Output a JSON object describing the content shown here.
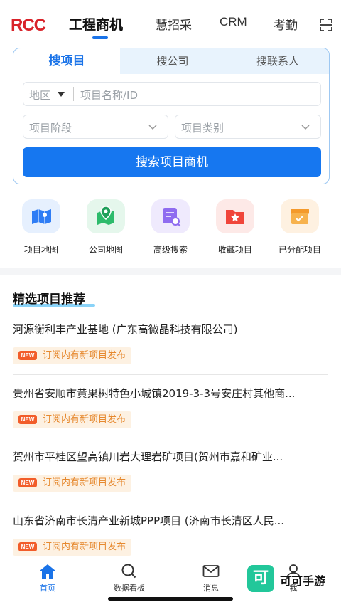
{
  "topnav": {
    "logo": "RCC",
    "tabs": [
      {
        "label": "工程商机",
        "active": true
      },
      {
        "label": "慧招采"
      },
      {
        "label": "CRM"
      },
      {
        "label": "考勤"
      }
    ],
    "scan_icon": "scan-icon"
  },
  "search_card": {
    "tabs": [
      {
        "label": "搜项目",
        "active": true
      },
      {
        "label": "搜公司"
      },
      {
        "label": "搜联系人"
      }
    ],
    "region_label": "地区",
    "name_placeholder": "项目名称/ID",
    "stage_placeholder": "项目阶段",
    "category_placeholder": "项目类别",
    "search_button": "搜索项目商机"
  },
  "quick_actions": [
    {
      "label": "项目地图",
      "icon": "project-map-icon",
      "color": "#2f7df5"
    },
    {
      "label": "公司地图",
      "icon": "company-map-icon",
      "color": "#2dbb6b"
    },
    {
      "label": "高级搜索",
      "icon": "advanced-search-icon",
      "color": "#8f6cf0"
    },
    {
      "label": "收藏项目",
      "icon": "favorite-folder-icon",
      "color": "#f0453a"
    },
    {
      "label": "已分配项目",
      "icon": "assigned-box-icon",
      "color": "#f49a2b"
    }
  ],
  "recommend": {
    "title": "精选项目推荐",
    "badge_text": "NEW",
    "items": [
      {
        "title": "河源衡利丰产业基地 (广东高微晶科技有限公司)",
        "tag": "订阅内有新项目发布"
      },
      {
        "title": "贵州省安顺市黄果树特色小城镇2019-3-3号安庄村其他商...",
        "tag": "订阅内有新项目发布"
      },
      {
        "title": "贺州市平桂区望高镇川岩大理岩矿项目(贺州市嘉和矿业...",
        "tag": "订阅内有新项目发布"
      },
      {
        "title": "山东省济南市长清产业新城PPP项目 (济南市长清区人民...",
        "tag": "订阅内有新项目发布"
      }
    ]
  },
  "bottom_nav": [
    {
      "label": "首页",
      "icon": "home-icon",
      "active": true
    },
    {
      "label": "数据看板",
      "icon": "search-icon"
    },
    {
      "label": "消息",
      "icon": "mail-icon"
    },
    {
      "label": "我",
      "icon": "user-icon"
    }
  ],
  "watermark": {
    "glyph": "可",
    "text": "可可手游"
  },
  "colors": {
    "primary": "#1677f0",
    "logo_red": "#d9232a",
    "tag_orange": "#e6892f",
    "new_badge": "#f25d2a"
  }
}
